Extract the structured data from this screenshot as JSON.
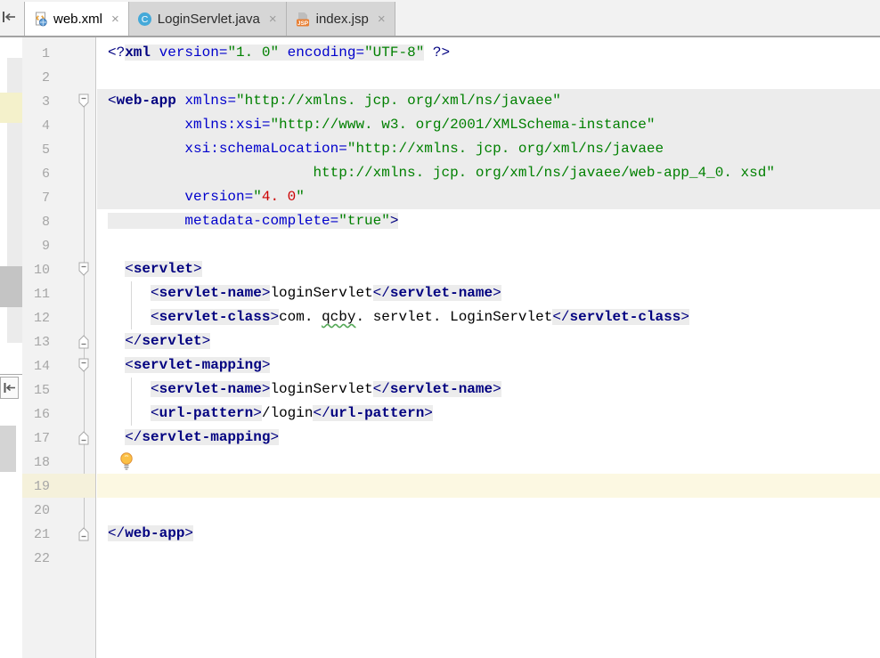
{
  "ui": {
    "close_symbol": "×"
  },
  "icons": {
    "active_tab_icon": "webxml-file-icon",
    "tab2_icon": "java-class-icon",
    "tab3_icon": "jsp-file-icon",
    "gutter_icons": [
      "fold-collapse-icon",
      "fold-expand-icon"
    ],
    "editor_icons": [
      "intention-lightbulb-icon"
    ],
    "strip_icons": [
      "dock-left-icon"
    ]
  },
  "colors": {
    "tab_bar_bg": "#F2F2F2",
    "inactive_tab_bg": "#D6D6D6",
    "active_tab_bg": "#FFFFFF",
    "gutter_bg": "#F2F2F2",
    "tag_highlight_bg": "#ECECEC",
    "caret_line_bg": "#FCF8E2",
    "tag_name": "#000080",
    "attribute_name": "#0000CC",
    "attribute_value": "#008000",
    "invalid_value": "#CC0000",
    "plain_text": "#000000",
    "line_number": "#A6A6A6"
  },
  "tabs": [
    {
      "label": "web.xml",
      "active": true
    },
    {
      "label": "LoginServlet.java",
      "active": false
    },
    {
      "label": "index.jsp",
      "active": false
    }
  ],
  "editor": {
    "caret_line": 19,
    "bulb_line": 18,
    "lines": [
      {
        "n": 1,
        "segs": [
          {
            "t": "<?",
            "s": "br"
          },
          {
            "t": "xml",
            "s": "tag",
            "bg": 1
          },
          {
            "t": " ",
            "s": "sp",
            "bg": 1
          },
          {
            "t": "version=",
            "s": "attr",
            "bg": 1
          },
          {
            "t": "\"1. 0\"",
            "s": "val",
            "bg": 1
          },
          {
            "t": " ",
            "s": "sp",
            "bg": 1
          },
          {
            "t": "encoding=",
            "s": "attr",
            "bg": 1
          },
          {
            "t": "\"UTF-8\"",
            "s": "val",
            "bg": 1
          },
          {
            "t": " ?>",
            "s": "br"
          }
        ]
      },
      {
        "n": 2,
        "segs": []
      },
      {
        "n": 3,
        "fullbg": true,
        "fold": "start",
        "segs": [
          {
            "t": "<",
            "s": "br"
          },
          {
            "t": "web-app",
            "s": "tag"
          },
          {
            "t": " ",
            "s": "sp"
          },
          {
            "t": "xmlns=",
            "s": "attr"
          },
          {
            "t": "\"http://xmlns. jcp. org/xml/ns/javaee\"",
            "s": "val"
          }
        ]
      },
      {
        "n": 4,
        "fullbg": true,
        "segs": [
          {
            "t": "         ",
            "s": "sp"
          },
          {
            "t": "xmlns:xsi=",
            "s": "attr"
          },
          {
            "t": "\"http://www. w3. org/2001/XMLSchema-instance\"",
            "s": "val"
          }
        ]
      },
      {
        "n": 5,
        "fullbg": true,
        "segs": [
          {
            "t": "         ",
            "s": "sp"
          },
          {
            "t": "xsi:schemaLocation=",
            "s": "attr"
          },
          {
            "t": "\"http://xmlns. jcp. org/xml/ns/javaee",
            "s": "val"
          }
        ]
      },
      {
        "n": 6,
        "fullbg": true,
        "segs": [
          {
            "t": "                        ",
            "s": "sp"
          },
          {
            "t": "http://xmlns. jcp. org/xml/ns/javaee/web-app_4_0. xsd\"",
            "s": "val"
          }
        ]
      },
      {
        "n": 7,
        "fullbg": true,
        "segs": [
          {
            "t": "         ",
            "s": "sp"
          },
          {
            "t": "version=",
            "s": "attr"
          },
          {
            "t": "\"",
            "s": "val"
          },
          {
            "t": "4. 0",
            "s": "num"
          },
          {
            "t": "\"",
            "s": "val"
          }
        ]
      },
      {
        "n": 8,
        "segs": [
          {
            "t": "         ",
            "s": "sp",
            "bg": 1
          },
          {
            "t": "metadata-complete=",
            "s": "attr",
            "bg": 1
          },
          {
            "t": "\"true\"",
            "s": "val",
            "bg": 1
          },
          {
            "t": ">",
            "s": "br",
            "bg": 1
          }
        ]
      },
      {
        "n": 9,
        "segs": []
      },
      {
        "n": 10,
        "fold": "start",
        "segs": [
          {
            "t": "  ",
            "s": "sp"
          },
          {
            "t": "<",
            "s": "br",
            "bg": 1
          },
          {
            "t": "servlet",
            "s": "tag",
            "bg": 1
          },
          {
            "t": ">",
            "s": "br",
            "bg": 1
          }
        ]
      },
      {
        "n": 11,
        "segs": [
          {
            "t": "     ",
            "s": "sp"
          },
          {
            "t": "<",
            "s": "br",
            "bg": 1
          },
          {
            "t": "servlet-name",
            "s": "tag",
            "bg": 1
          },
          {
            "t": ">",
            "s": "br",
            "bg": 1
          },
          {
            "t": "loginServlet",
            "s": "txt"
          },
          {
            "t": "</",
            "s": "br",
            "bg": 1
          },
          {
            "t": "servlet-name",
            "s": "tag",
            "bg": 1
          },
          {
            "t": ">",
            "s": "br",
            "bg": 1
          }
        ]
      },
      {
        "n": 12,
        "segs": [
          {
            "t": "     ",
            "s": "sp"
          },
          {
            "t": "<",
            "s": "br",
            "bg": 1
          },
          {
            "t": "servlet-class",
            "s": "tag",
            "bg": 1
          },
          {
            "t": ">",
            "s": "br",
            "bg": 1
          },
          {
            "t": "com. ",
            "s": "txt"
          },
          {
            "t": "qcby",
            "s": "typo"
          },
          {
            "t": ". servlet. LoginServlet",
            "s": "txt"
          },
          {
            "t": "</",
            "s": "br",
            "bg": 1
          },
          {
            "t": "servlet-class",
            "s": "tag",
            "bg": 1
          },
          {
            "t": ">",
            "s": "br",
            "bg": 1
          }
        ]
      },
      {
        "n": 13,
        "fold": "end",
        "segs": [
          {
            "t": "  ",
            "s": "sp"
          },
          {
            "t": "</",
            "s": "br",
            "bg": 1
          },
          {
            "t": "servlet",
            "s": "tag",
            "bg": 1
          },
          {
            "t": ">",
            "s": "br",
            "bg": 1
          }
        ]
      },
      {
        "n": 14,
        "fold": "start",
        "segs": [
          {
            "t": "  ",
            "s": "sp"
          },
          {
            "t": "<",
            "s": "br",
            "bg": 1
          },
          {
            "t": "servlet-mapping",
            "s": "tag",
            "bg": 1
          },
          {
            "t": ">",
            "s": "br",
            "bg": 1
          }
        ]
      },
      {
        "n": 15,
        "segs": [
          {
            "t": "     ",
            "s": "sp"
          },
          {
            "t": "<",
            "s": "br",
            "bg": 1
          },
          {
            "t": "servlet-name",
            "s": "tag",
            "bg": 1
          },
          {
            "t": ">",
            "s": "br",
            "bg": 1
          },
          {
            "t": "loginServlet",
            "s": "txt"
          },
          {
            "t": "</",
            "s": "br",
            "bg": 1
          },
          {
            "t": "servlet-name",
            "s": "tag",
            "bg": 1
          },
          {
            "t": ">",
            "s": "br",
            "bg": 1
          }
        ]
      },
      {
        "n": 16,
        "segs": [
          {
            "t": "     ",
            "s": "sp"
          },
          {
            "t": "<",
            "s": "br",
            "bg": 1
          },
          {
            "t": "url-pattern",
            "s": "tag",
            "bg": 1
          },
          {
            "t": ">",
            "s": "br",
            "bg": 1
          },
          {
            "t": "/login",
            "s": "txt"
          },
          {
            "t": "</",
            "s": "br",
            "bg": 1
          },
          {
            "t": "url-pattern",
            "s": "tag",
            "bg": 1
          },
          {
            "t": ">",
            "s": "br",
            "bg": 1
          }
        ]
      },
      {
        "n": 17,
        "fold": "end",
        "segs": [
          {
            "t": "  ",
            "s": "sp"
          },
          {
            "t": "</",
            "s": "br",
            "bg": 1
          },
          {
            "t": "servlet-mapping",
            "s": "tag",
            "bg": 1
          },
          {
            "t": ">",
            "s": "br",
            "bg": 1
          }
        ]
      },
      {
        "n": 18,
        "bulb": true,
        "segs": []
      },
      {
        "n": 19,
        "caret": true,
        "segs": []
      },
      {
        "n": 20,
        "segs": []
      },
      {
        "n": 21,
        "fold": "end",
        "segs": [
          {
            "t": "</",
            "s": "br",
            "bg": 1
          },
          {
            "t": "web-app",
            "s": "tag",
            "bg": 1
          },
          {
            "t": ">",
            "s": "br",
            "bg": 1
          }
        ]
      },
      {
        "n": 22,
        "segs": []
      }
    ]
  }
}
